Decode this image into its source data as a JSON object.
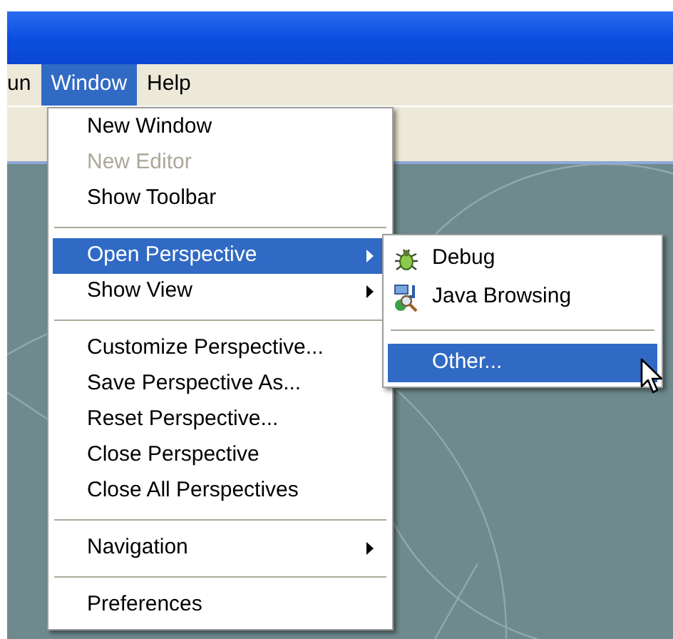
{
  "menubar": [
    {
      "label": "un",
      "selected": false
    },
    {
      "label": "Window",
      "selected": true
    },
    {
      "label": "Help",
      "selected": false
    }
  ],
  "window_menu": [
    {
      "kind": "item",
      "label": "New Window",
      "disabled": false,
      "selected": false,
      "submenu": false
    },
    {
      "kind": "item",
      "label": "New Editor",
      "disabled": true,
      "selected": false,
      "submenu": false
    },
    {
      "kind": "item",
      "label": "Show Toolbar",
      "disabled": false,
      "selected": false,
      "submenu": false
    },
    {
      "kind": "separator"
    },
    {
      "kind": "item",
      "label": "Open Perspective",
      "disabled": false,
      "selected": true,
      "submenu": true
    },
    {
      "kind": "item",
      "label": "Show View",
      "disabled": false,
      "selected": false,
      "submenu": true
    },
    {
      "kind": "separator"
    },
    {
      "kind": "item",
      "label": "Customize Perspective...",
      "disabled": false,
      "selected": false,
      "submenu": false
    },
    {
      "kind": "item",
      "label": "Save Perspective As...",
      "disabled": false,
      "selected": false,
      "submenu": false
    },
    {
      "kind": "item",
      "label": "Reset Perspective...",
      "disabled": false,
      "selected": false,
      "submenu": false
    },
    {
      "kind": "item",
      "label": "Close Perspective",
      "disabled": false,
      "selected": false,
      "submenu": false
    },
    {
      "kind": "item",
      "label": "Close All Perspectives",
      "disabled": false,
      "selected": false,
      "submenu": false
    },
    {
      "kind": "separator"
    },
    {
      "kind": "item",
      "label": "Navigation",
      "disabled": false,
      "selected": false,
      "submenu": true
    },
    {
      "kind": "separator"
    },
    {
      "kind": "item",
      "label": "Preferences",
      "disabled": false,
      "selected": false,
      "submenu": false
    }
  ],
  "perspective_submenu": [
    {
      "kind": "debug",
      "label": "Debug",
      "selected": false
    },
    {
      "kind": "browsing",
      "label": "Java Browsing",
      "selected": false
    },
    {
      "kind": "separator"
    },
    {
      "kind": "plain",
      "label": "Other...",
      "selected": true
    }
  ]
}
